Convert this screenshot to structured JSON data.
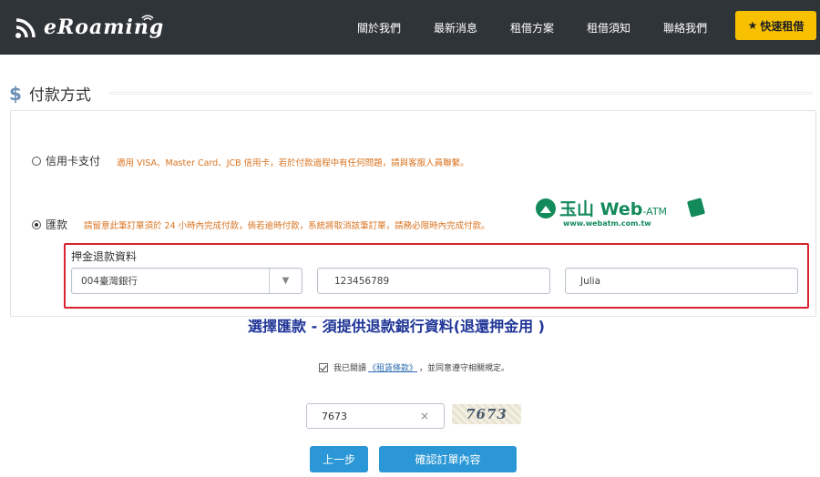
{
  "header": {
    "brand": "eRoaming",
    "nav": [
      "關於我們",
      "最新消息",
      "租借方案",
      "租借須知",
      "聯絡我們"
    ],
    "quick_rent": "快速租借"
  },
  "section": {
    "icon": "$",
    "title": "付款方式"
  },
  "payment": {
    "credit_card": {
      "label": "信用卡支付",
      "selected": false,
      "note": "適用 VISA、Master Card、JCB 信用卡，若於付款過程中有任何問題，請與客服人員聯繫。"
    },
    "transfer": {
      "label": "匯款",
      "selected": true,
      "note": "請留意此筆訂單須於 24 小時內完成付款，倘若逾時付款，系統將取消該筆訂單，請務必限時內完成付款。"
    },
    "bank_logo": {
      "name": "玉山",
      "brand": "Web",
      "suffix": "-ATM",
      "url": "www.webatm.com.tw"
    }
  },
  "refund": {
    "title": "押金退款資料",
    "bank": "004臺灣銀行",
    "account": "123456789",
    "name": "Julia"
  },
  "caption": "選擇匯款 - 須提供退款銀行資料(退還押金用 )",
  "agreement": {
    "prefix": "我已閱讀",
    "link": "《租賃條款》",
    "suffix": "，並同意遵守相關規定。",
    "checked": true
  },
  "captcha": {
    "input_value": "7673",
    "clear": "×",
    "image_text": "7673"
  },
  "buttons": {
    "prev": "上一步",
    "confirm": "確認訂單內容"
  },
  "colors": {
    "header_bg": "#2f3438",
    "accent_yellow": "#f7c000",
    "note_orange": "#d9731f",
    "highlight_red": "#d9232e",
    "caption_blue": "#1f3597",
    "button_blue": "#2b97d6",
    "bank_green": "#138a5a"
  }
}
